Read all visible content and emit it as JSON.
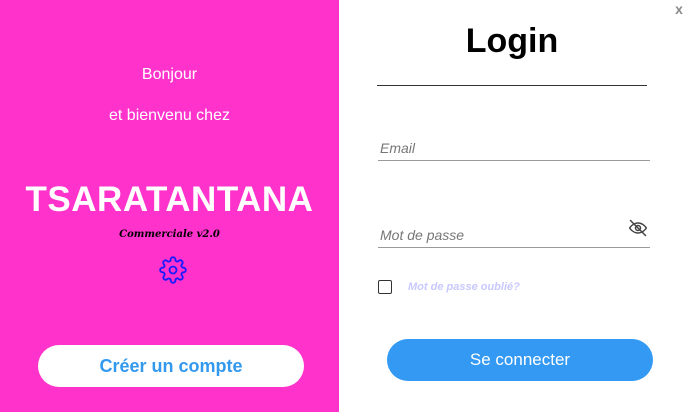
{
  "welcome": {
    "line1": "Bonjour",
    "line2": "et bienvenu chez",
    "brand": "TSARATANTANA",
    "version": "Commerciale v2.0",
    "settings_icon": "gear-icon",
    "create_account_label": "Créer un compte"
  },
  "login": {
    "close_label": "x",
    "title": "Login",
    "email_placeholder": "Email",
    "email_value": "",
    "password_placeholder": "Mot de passe",
    "password_value": "",
    "password_toggle_icon": "eye-slash-icon",
    "remember_checked": false,
    "forgot_label": "Mot de passe oublié?",
    "submit_label": "Se connecter"
  },
  "colors": {
    "panel_background": "#ff33cc",
    "primary_button": "#3399f3",
    "create_button_text": "#3399ee",
    "forgot_link": "#c8c8ff",
    "settings_icon": "#1a1aff"
  }
}
